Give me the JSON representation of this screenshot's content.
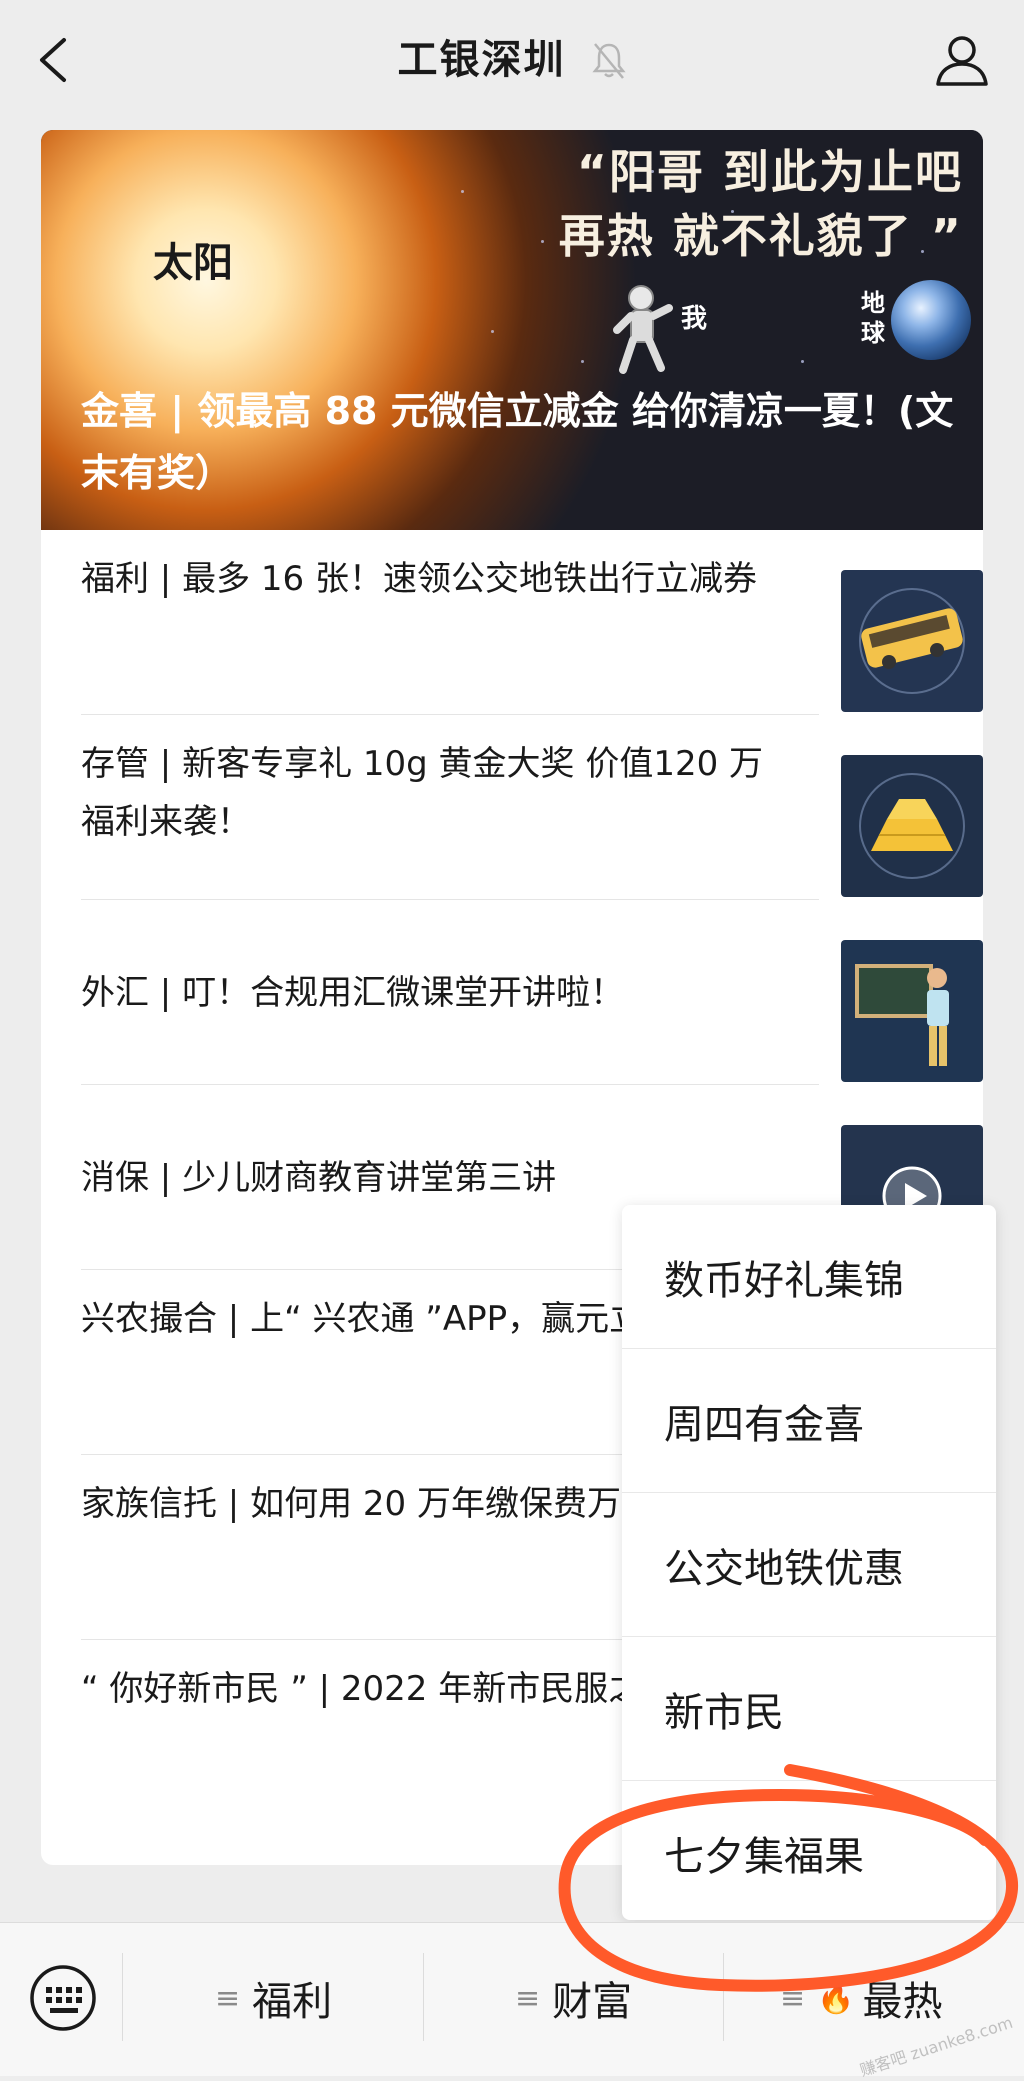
{
  "header": {
    "title": "工银深圳",
    "back_icon": "chevron-left-icon",
    "mute_icon": "bell-muted-icon",
    "profile_icon": "user-icon"
  },
  "banner": {
    "sun_label": "太阳",
    "quote_line1": "“阳哥 到此为止吧",
    "quote_line2": "再热 就不礼貌了 ”",
    "me_label": "我",
    "earth_label": "地球",
    "headline": "金喜 | 领最高 88 元微信立减金 给你清凉一夏！(文末有奖）"
  },
  "articles": [
    {
      "title": "福利 | 最多 16 张！速领公交地铁出行立减券",
      "thumb": "bus"
    },
    {
      "title": "存管 | 新客专享礼 10g 黄金大奖 价值120 万福利来袭！",
      "thumb": "gold"
    },
    {
      "title": "外汇 | 叮！合规用汇微课堂开讲啦！",
      "thumb": "teacher"
    },
    {
      "title": "消保 | 少儿财商教育讲堂第三讲",
      "thumb": "video"
    },
    {
      "title": "兴农撮合 | 上“ 兴农通 ”APP，赢元立减金！",
      "thumb": ""
    },
    {
      "title": "家族信托 | 如何用 20 万年缴保费万家族信托",
      "thumb": ""
    },
    {
      "title": "“ 你好新市民 ” | 2022 年新市民服之文化篇",
      "thumb": ""
    }
  ],
  "popup_menu": {
    "items": [
      "数币好礼集锦",
      "周四有金喜",
      "公交地铁优惠",
      "新市民",
      "七夕集福果"
    ]
  },
  "bottom_bar": {
    "keyboard_icon": "keyboard-icon",
    "tabs": [
      "福利",
      "财富",
      "最热"
    ]
  },
  "colors": {
    "background": "#ededed",
    "card": "#ffffff",
    "annotation_circle": "#ff5a2a"
  },
  "watermark": "赚客吧 zuanke8.com"
}
